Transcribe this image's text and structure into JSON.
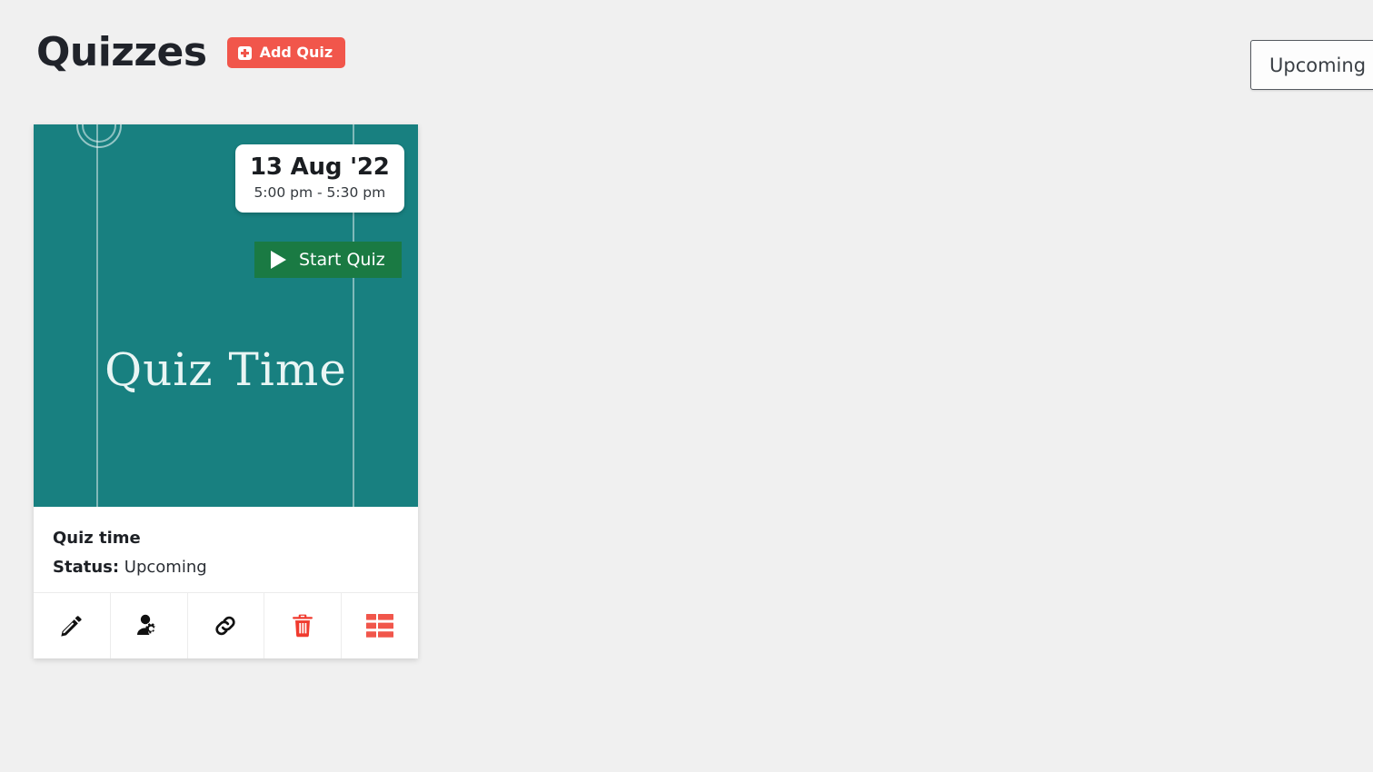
{
  "header": {
    "title": "Quizzes",
    "add_button": {
      "label": "Add Quiz",
      "icon": "plus-square-icon",
      "color": "#f1564b"
    }
  },
  "filter": {
    "selected": "Upcoming",
    "options": [
      "Upcoming"
    ]
  },
  "theme": {
    "page_background": "#f0f0f0",
    "accent_red": "#f1564b",
    "banner_teal": "#188080",
    "start_green": "#1a7a43"
  },
  "quiz_cards": [
    {
      "banner": {
        "title": "Quiz Time",
        "background_color": "#188080",
        "date": "13 Aug '22",
        "time_range": "5:00 pm - 5:30 pm",
        "start_button": {
          "label": "Start Quiz",
          "icon": "play-icon"
        }
      },
      "name": "Quiz time",
      "status_label": "Status:",
      "status_value": "Upcoming",
      "actions": [
        {
          "name": "edit",
          "icon": "pencil-icon",
          "color": "#111111"
        },
        {
          "name": "manage-users",
          "icon": "user-gear-icon",
          "color": "#111111"
        },
        {
          "name": "copy-link",
          "icon": "link-icon",
          "color": "#111111"
        },
        {
          "name": "delete",
          "icon": "trash-icon",
          "color": "#f03a2e"
        },
        {
          "name": "results",
          "icon": "table-grid-icon",
          "color": "#f1564b"
        }
      ]
    }
  ]
}
